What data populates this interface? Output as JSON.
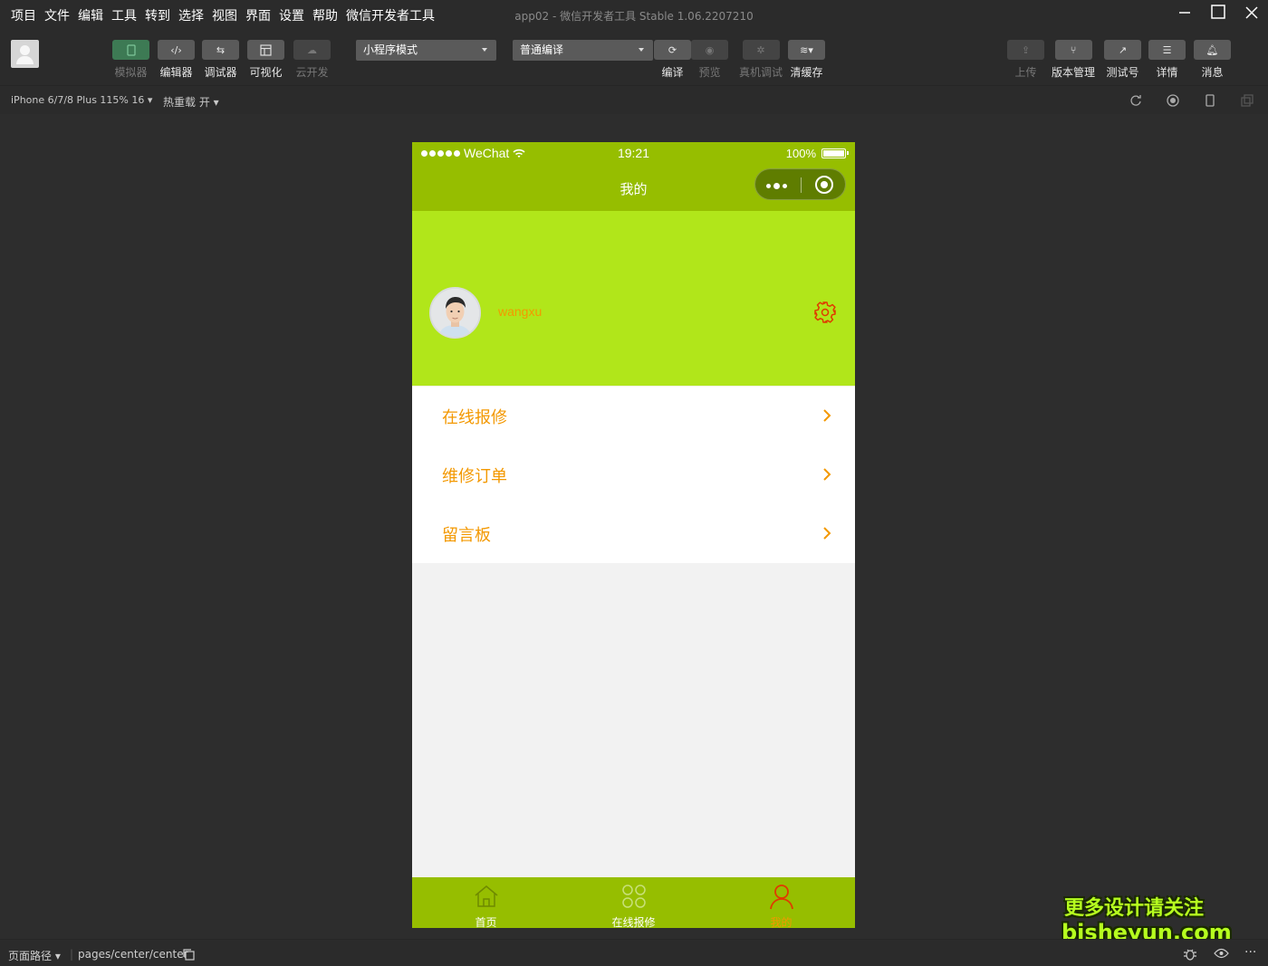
{
  "menubar": {
    "menus": [
      "项目",
      "文件",
      "编辑",
      "工具",
      "转到",
      "选择",
      "视图",
      "界面",
      "设置",
      "帮助",
      "微信开发者工具"
    ],
    "window_title": "app02 - 微信开发者工具 Stable 1.06.2207210"
  },
  "toolbar": {
    "simulator": "模拟器",
    "editor": "编辑器",
    "debugger": "调试器",
    "visual": "可视化",
    "cloud": "云开发",
    "mode_select": "小程序模式",
    "compile_select": "普通编译",
    "compile": "编译",
    "preview": "预览",
    "real_debug": "真机调试",
    "clear_cache": "清缓存",
    "upload": "上传",
    "version": "版本管理",
    "test_account": "测试号",
    "details": "详情",
    "messages": "消息"
  },
  "subbar": {
    "device": "iPhone 6/7/8 Plus 115% 16 ▾",
    "hot_reload": "热重载 开 ▾"
  },
  "phone": {
    "carrier": "WeChat",
    "time": "19:21",
    "battery": "100%",
    "nav_title": "我的",
    "username": "wangxu",
    "menu": [
      {
        "label": "在线报修"
      },
      {
        "label": "维修订单"
      },
      {
        "label": "留言板"
      }
    ],
    "tabs": [
      {
        "label": "首页",
        "icon": "home-icon",
        "active": false
      },
      {
        "label": "在线报修",
        "icon": "grid-icon",
        "active": false
      },
      {
        "label": "我的",
        "icon": "user-icon",
        "active": true
      }
    ]
  },
  "watermark": {
    "line1": "更多设计请关注",
    "line2": "bisheyun.com"
  },
  "footer": {
    "path_label": "页面路径 ▾",
    "path": "pages/center/center"
  },
  "colors": {
    "nav_green": "#96be00",
    "header_green": "#b1e61a",
    "accent_orange": "#f39800",
    "gear_red": "#e03a00"
  }
}
